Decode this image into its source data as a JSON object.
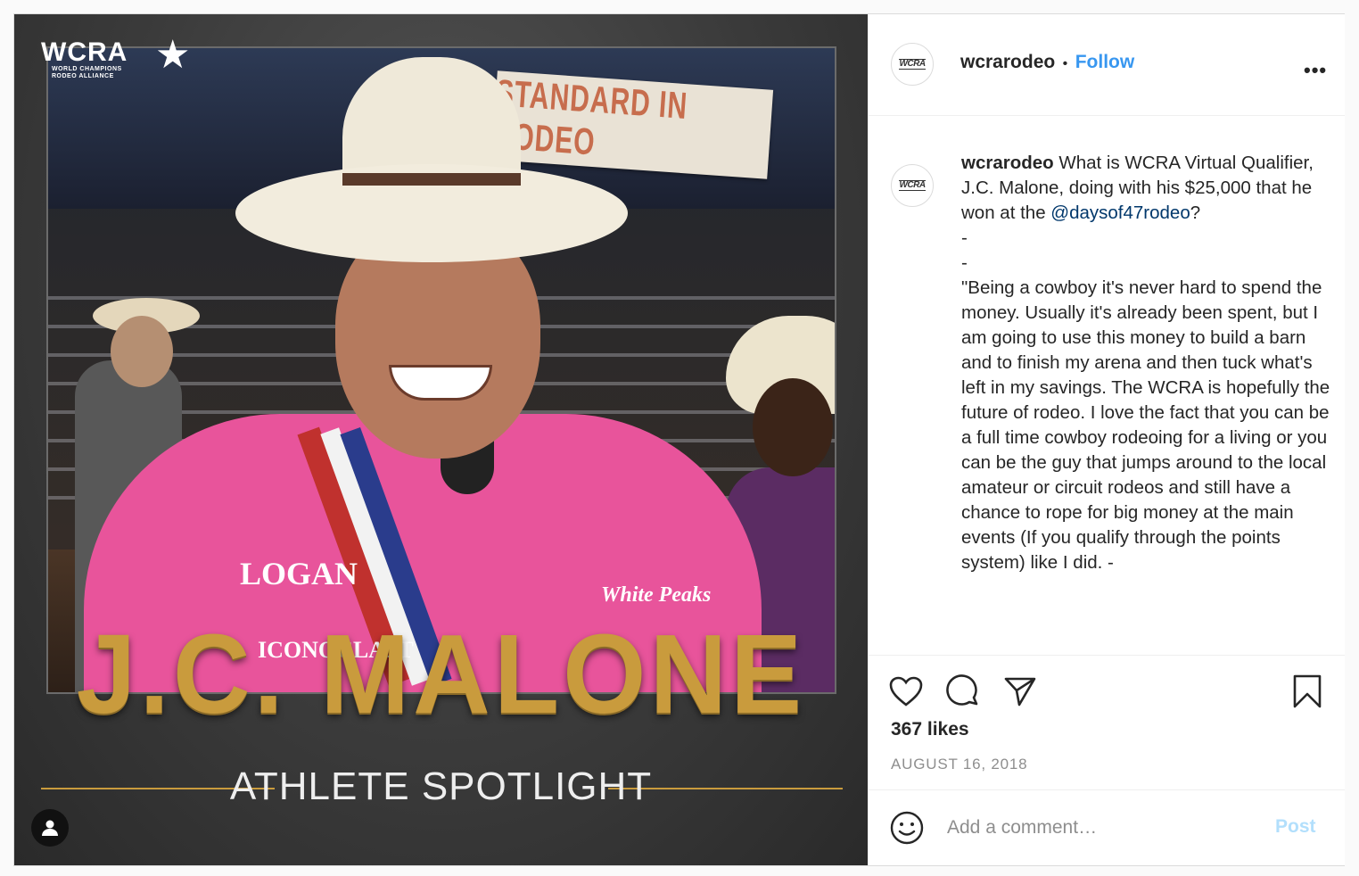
{
  "media": {
    "logo_text": "WCRA",
    "logo_subtitle_1": "WORLD CHAMPIONS",
    "logo_subtitle_2": "RODEO ALLIANCE",
    "banner_text": "STANDARD IN RODEO",
    "shirt_text_1": "LOGAN",
    "shirt_text_2": "ICONOCLAST",
    "shirt_text_3": "White Peaks",
    "athlete_name": "J.C. MALONE",
    "spotlight_label": "ATHLETE SPOTLIGHT",
    "user_tag_icon": "person-icon"
  },
  "header": {
    "username": "wcrarodeo",
    "separator": "•",
    "follow_label": "Follow",
    "more_icon": "•••",
    "avatar_text": "WCRA"
  },
  "caption": {
    "username": "wcrarodeo",
    "text_part1": "What is WCRA Virtual Qualifier, J.C. Malone, doing with his $25,000 that he won at the",
    "mention": "@daysof47rodeo",
    "text_part2": "?",
    "dash1": "-",
    "dash2": "-",
    "quote": "\"Being a cowboy it's never hard to spend the money. Usually it's already been spent, but I am going to use this money to build a barn and to finish my arena and then tuck what's left in my savings. The WCRA is hopefully the future of rodeo. I love the fact that you can be a full time cowboy rodeoing for a living or you can be the guy that jumps around to the local amateur or circuit rodeos and still have a chance to rope for big money at the main events (If you qualify through the points system) like I did. -"
  },
  "actions": {
    "likes": "367 likes",
    "date": "AUGUST 16, 2018"
  },
  "comment": {
    "placeholder": "Add a comment…",
    "post_label": "Post"
  },
  "colors": {
    "accent": "#3897f0",
    "post_disabled": "#b2dffc",
    "gold": "#c99b3d",
    "shirt_pink": "#e8549b"
  }
}
